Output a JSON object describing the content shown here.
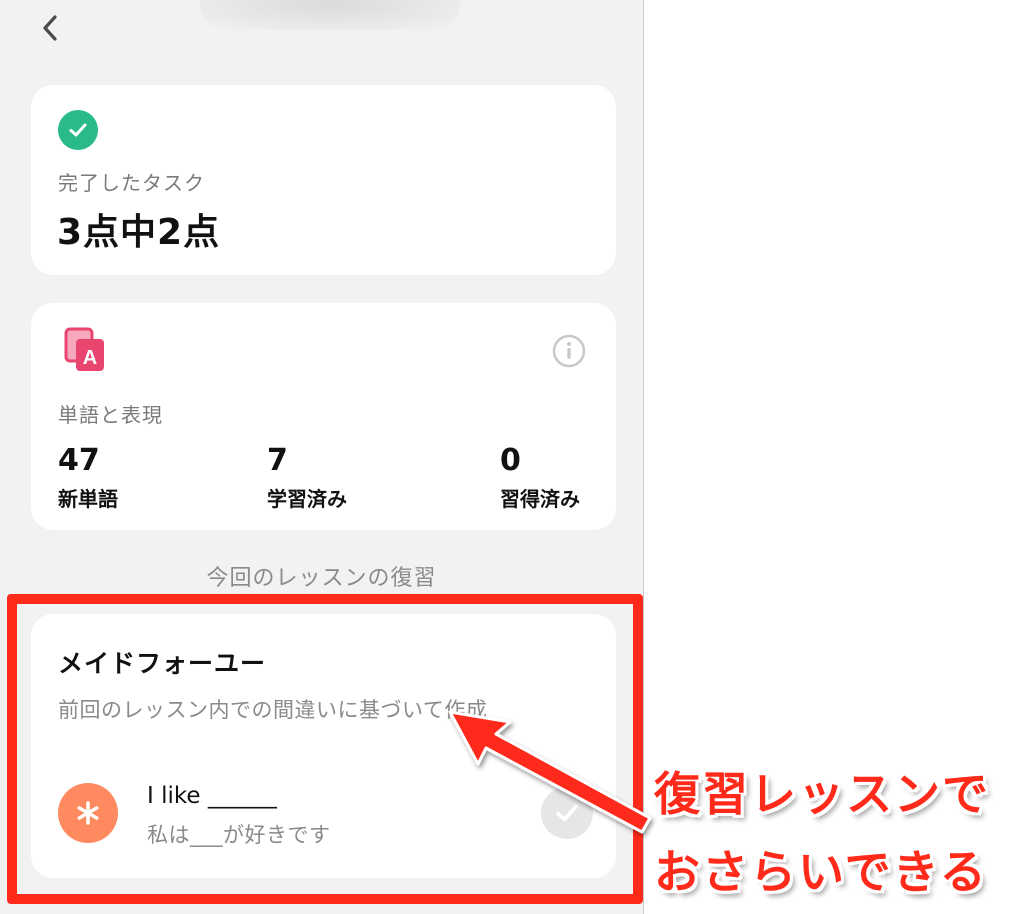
{
  "task_card": {
    "label": "完了したタスク",
    "count": "3点中2点"
  },
  "vocab_card": {
    "label": "単語と表現",
    "stats": [
      {
        "value": "47",
        "label": "新単語"
      },
      {
        "value": "7",
        "label": "学習済み"
      },
      {
        "value": "0",
        "label": "習得済み"
      }
    ]
  },
  "review_section": {
    "title": "今回のレッスンの復習"
  },
  "made_for_you": {
    "title": "メイドフォーユー",
    "subtitle": "前回のレッスン内での間違いに基づいて作成",
    "exercise": {
      "english": "I like ______",
      "japanese": "私は___が好きです"
    }
  },
  "annotation": {
    "line1": "復習レッスンで",
    "line2": "おさらいできる"
  },
  "colors": {
    "accent_green": "#2ab98a",
    "vocab_pink": "#e8456f",
    "avatar_orange": "#ff8a5f",
    "highlight_red": "#ff2a1a"
  },
  "icons": {
    "back": "chevron-left-icon",
    "task_done": "check-circle-icon",
    "vocab": "vocabulary-cards-icon",
    "info": "info-icon",
    "avatar": "asterisk-icon",
    "exercise_done": "check-icon"
  }
}
